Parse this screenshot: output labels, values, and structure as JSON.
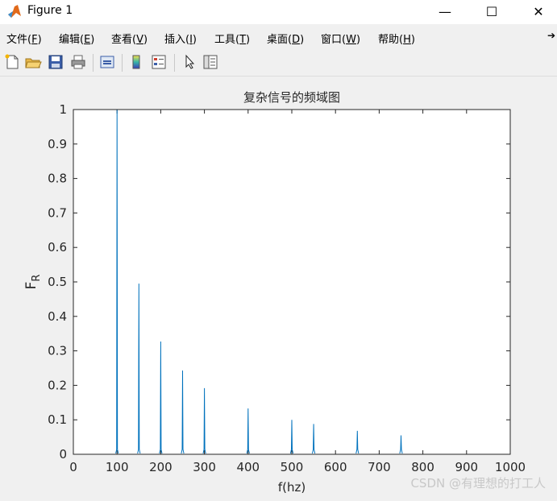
{
  "window": {
    "title": "Figure 1",
    "minimize": "—",
    "maximize": "☐",
    "close": "✕"
  },
  "menu": [
    {
      "label": "文件(",
      "key": "F",
      "end": ")"
    },
    {
      "label": "编辑(",
      "key": "E",
      "end": ")"
    },
    {
      "label": "查看(",
      "key": "V",
      "end": ")"
    },
    {
      "label": "插入(",
      "key": "I",
      "end": ")"
    },
    {
      "label": "工具(",
      "key": "T",
      "end": ")"
    },
    {
      "label": "桌面(",
      "key": "D",
      "end": ")"
    },
    {
      "label": "窗口(",
      "key": "W",
      "end": ")"
    },
    {
      "label": "帮助(",
      "key": "H",
      "end": ")"
    }
  ],
  "toolbar_icons": [
    "new-figure-icon",
    "open-file-icon",
    "save-icon",
    "print-icon",
    "link-plot-icon",
    "colorbar-icon",
    "legend-icon",
    "pointer-icon",
    "property-inspector-icon"
  ],
  "chart_data": {
    "type": "line",
    "title": "复杂信号的频域图",
    "xlabel": "f(hz)",
    "ylabel": "F",
    "ylabel_sub": "R",
    "xlim": [
      0,
      1000
    ],
    "ylim": [
      0,
      1
    ],
    "xticks": [
      0,
      100,
      200,
      300,
      400,
      500,
      600,
      700,
      800,
      900,
      1000
    ],
    "yticks": [
      0,
      0.1,
      0.2,
      0.3,
      0.4,
      0.5,
      0.6,
      0.7,
      0.8,
      0.9,
      1
    ],
    "ytick_labels": [
      "0",
      "0.1",
      "0.2",
      "0.3",
      "0.4",
      "0.5",
      "0.6",
      "0.7",
      "0.8",
      "0.9",
      "1"
    ],
    "series": [
      {
        "x": [
          100,
          150,
          200,
          250,
          300,
          400,
          500,
          550,
          650,
          750
        ],
        "y": [
          1.0,
          0.495,
          0.327,
          0.243,
          0.192,
          0.133,
          0.1,
          0.088,
          0.068,
          0.055
        ],
        "color": "#0072bd"
      }
    ],
    "grid": false
  },
  "watermark": "CSDN @有理想的打工人"
}
